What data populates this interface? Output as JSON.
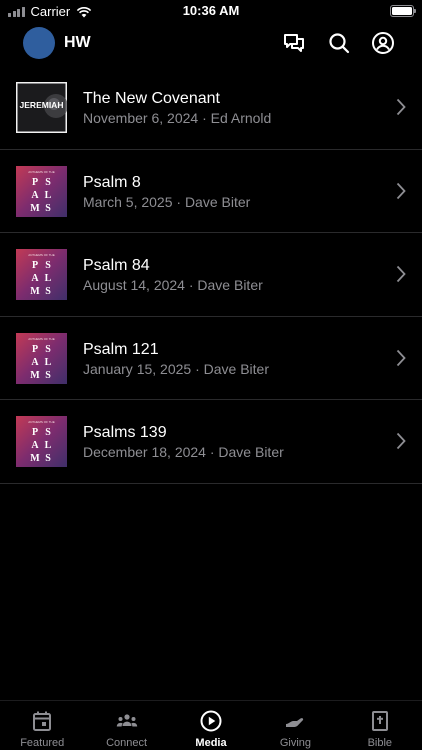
{
  "status_bar": {
    "carrier": "Carrier",
    "time": "10:36 AM"
  },
  "header": {
    "org": "HW"
  },
  "thumbs": {
    "jeremiah": "JEREMIAH",
    "psalms_top": "ANTHEMS OF THE",
    "psalms": [
      "P",
      "S",
      "A",
      "L",
      "M",
      "S"
    ]
  },
  "items": [
    {
      "title": "The New Covenant",
      "subtitle": "November 6, 2024 · Ed Arnold",
      "thumb": "jeremiah"
    },
    {
      "title": "Psalm 8",
      "subtitle": "March 5, 2025 · Dave Biter",
      "thumb": "psalms"
    },
    {
      "title": "Psalm 84",
      "subtitle": "August 14, 2024 · Dave Biter",
      "thumb": "psalms"
    },
    {
      "title": "Psalm 121",
      "subtitle": "January 15, 2025 · Dave Biter",
      "thumb": "psalms"
    },
    {
      "title": "Psalms 139",
      "subtitle": "December 18, 2024 · Dave Biter",
      "thumb": "psalms"
    }
  ],
  "tabs": [
    {
      "label": "Featured",
      "icon": "calendar-icon",
      "active": false
    },
    {
      "label": "Connect",
      "icon": "people-icon",
      "active": false
    },
    {
      "label": "Media",
      "icon": "play-circle-icon",
      "active": true
    },
    {
      "label": "Giving",
      "icon": "giving-hand-icon",
      "active": false
    },
    {
      "label": "Bible",
      "icon": "bible-icon",
      "active": false
    }
  ],
  "colors": {
    "background": "#000000",
    "secondary_text": "#8e8e93",
    "avatar": "#2f5e9e",
    "divider": "#2a2a2c"
  }
}
